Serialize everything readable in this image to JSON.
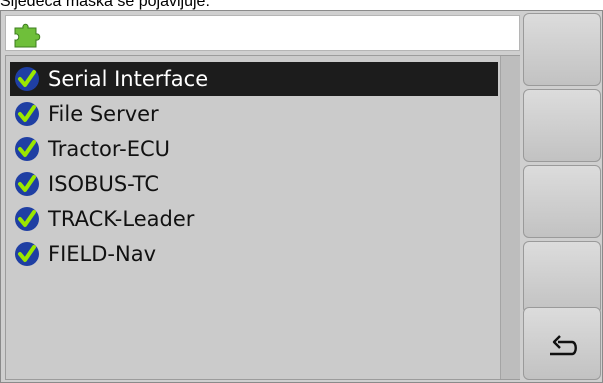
{
  "caption": "Sljedeća maska se pojavljuje:",
  "header": {
    "icon": "puzzle-plugin-icon",
    "title": ""
  },
  "list": {
    "items": [
      {
        "label": "Serial Interface",
        "icon": "checkmark-icon",
        "selected": true
      },
      {
        "label": "File Server",
        "icon": "checkmark-icon",
        "selected": false
      },
      {
        "label": "Tractor-ECU",
        "icon": "checkmark-icon",
        "selected": false
      },
      {
        "label": "ISOBUS-TC",
        "icon": "checkmark-icon",
        "selected": false
      },
      {
        "label": "TRACK-Leader",
        "icon": "checkmark-icon",
        "selected": false
      },
      {
        "label": "FIELD-Nav",
        "icon": "checkmark-icon",
        "selected": false
      }
    ]
  },
  "softkeys": [
    {
      "label": "",
      "icon": ""
    },
    {
      "label": "",
      "icon": ""
    },
    {
      "label": "",
      "icon": ""
    },
    {
      "label": "",
      "icon": ""
    },
    {
      "label": "",
      "icon": "back-arrow-icon"
    }
  ],
  "colors": {
    "selection": "#1c1c1c",
    "check_circle": "#1f3fa3",
    "check_mark": "#9be800",
    "puzzle": "#6fbf3a"
  }
}
